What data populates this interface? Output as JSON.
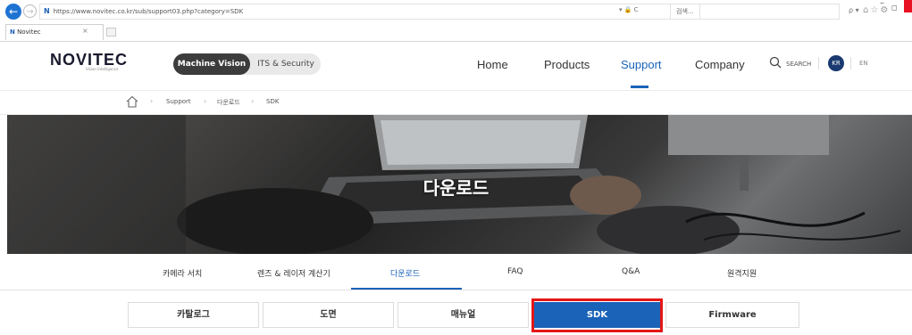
{
  "browser": {
    "url": "https://www.novitec.co.kr/sub/support03.php?category=SDK",
    "address_controls": "▾ 🔒 C",
    "search_placeholder": "검색...",
    "search_go": "ρ ▾",
    "tab_title": "Novitec",
    "favicon_letter": "N",
    "back_glyph": "←",
    "forward_glyph": "→"
  },
  "header": {
    "logo": "NOVITEC",
    "logo_tagline": "Vision Intelligence",
    "segments": [
      "Machine Vision",
      "ITS & Security"
    ],
    "nav": [
      "Home",
      "Products",
      "Support",
      "Company"
    ],
    "search_label": "SEARCH",
    "lang_active": "KR",
    "lang_other": "EN"
  },
  "breadcrumb": [
    "Support",
    "다운로드",
    "SDK"
  ],
  "hero": {
    "title": "다운로드"
  },
  "subnav": [
    "카메라 서치",
    "렌즈 & 레이저 계산기",
    "다운로드",
    "FAQ",
    "Q&A",
    "원격지원"
  ],
  "categories": [
    "카탈로그",
    "도면",
    "매뉴얼",
    "SDK",
    "Firmware"
  ],
  "colors": {
    "accent": "#1a63b8",
    "highlight": "#e51616"
  }
}
